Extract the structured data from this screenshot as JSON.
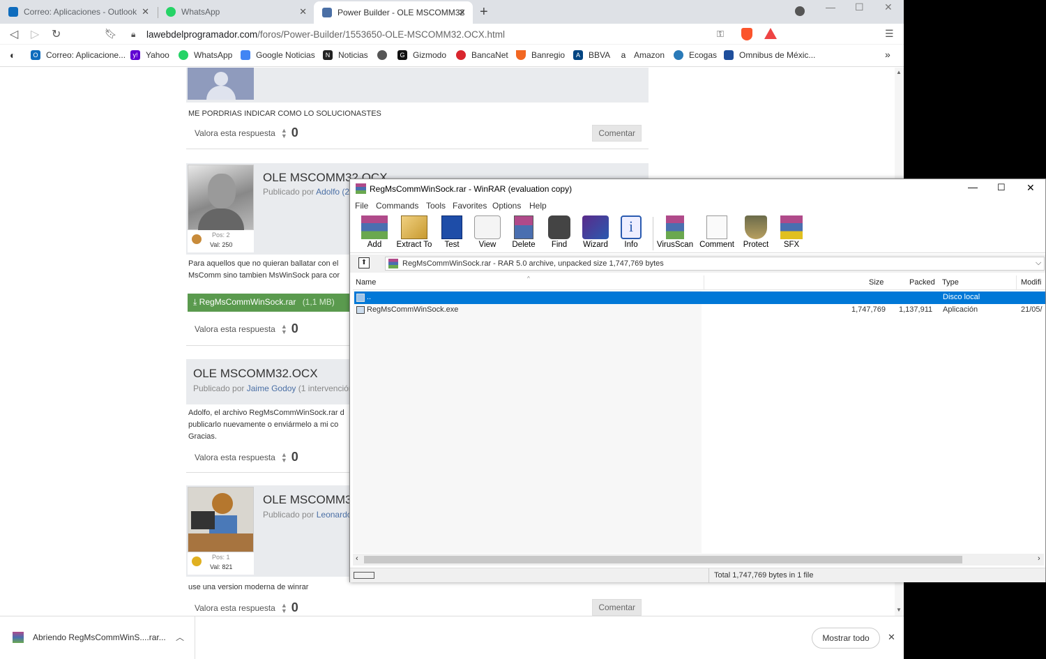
{
  "browser": {
    "tabs": [
      {
        "title": "Correo: Aplicaciones - Outlook",
        "color": "#0f6cbd"
      },
      {
        "title": "WhatsApp",
        "color": "#25d366"
      },
      {
        "title": "Power Builder - OLE MSCOMM32",
        "color": "#4a6fa5"
      }
    ],
    "url_domain": "lawebdelprogramador.com",
    "url_path": "/foros/Power-Builder/1553650-OLE-MSCOMM32.OCX.html",
    "bookmarks": [
      {
        "label": "Correo: Aplicacione...",
        "color": "#0f6cbd"
      },
      {
        "label": "Yahoo",
        "color": "#6001d2"
      },
      {
        "label": "WhatsApp",
        "color": "#25d366"
      },
      {
        "label": "Google Noticias",
        "color": "#4285f4"
      },
      {
        "label": "Noticias",
        "color": "#222"
      },
      {
        "label": "",
        "color": "#555"
      },
      {
        "label": "Gizmodo",
        "color": "#111"
      },
      {
        "label": "BancaNet",
        "color": "#d9262e"
      },
      {
        "label": "Banregio",
        "color": "#f26722"
      },
      {
        "label": "BBVA",
        "color": "#004481"
      },
      {
        "label": "Amazon",
        "color": "#222"
      },
      {
        "label": "Ecogas",
        "color": "#2a7ab8"
      },
      {
        "label": "Omnibus de Méxic...",
        "color": "#1e4e9c"
      }
    ]
  },
  "forum": {
    "post0": {
      "text": "ME PORDRIAS INDICAR COMO LO SOLUCIONASTES",
      "rate_label": "Valora esta respuesta",
      "votes": "0",
      "comment": "Comentar"
    },
    "post1": {
      "title": "OLE MSCOMM32.OCX",
      "published": "Publicado por",
      "author": "Adolfo (2",
      "pos": "Pos: 2",
      "val": "Val: 250",
      "line1": "Para aquellos que no quieran ballatar con el",
      "line2": "MsComm sino tambien MsWinSock para cor",
      "attachment": "RegMsCommWinSock.rar",
      "attachment_size": "(1,1 MB)",
      "rate_label": "Valora esta respuesta",
      "votes": "0"
    },
    "post2": {
      "title": "OLE MSCOMM32.OCX",
      "published": "Publicado por",
      "author": "Jaime Godoy",
      "extra": "(1 intervención",
      "line1": "Adolfo, el archivo RegMsCommWinSock.rar d",
      "line2": "publicarlo nuevamente o enviármelo a mi co",
      "line3": "Gracias.",
      "rate_label": "Valora esta respuesta",
      "votes": "0"
    },
    "post3": {
      "title": "OLE MSCOMM3",
      "published": "Publicado por",
      "author": "Leonardo",
      "pos": "Pos: 1",
      "val": "Val: 821",
      "text": "use una version moderna de winrar",
      "rate_label": "Valora esta respuesta",
      "votes": "0",
      "comment": "Comentar"
    }
  },
  "download": {
    "file": "Abriendo RegMsCommWinS....rar...",
    "show_all": "Mostrar todo"
  },
  "winrar": {
    "title": "RegMsCommWinSock.rar - WinRAR (evaluation copy)",
    "menu": [
      "File",
      "Commands",
      "Tools",
      "Favorites",
      "Options",
      "Help"
    ],
    "tools": [
      "Add",
      "Extract To",
      "Test",
      "View",
      "Delete",
      "Find",
      "Wizard",
      "Info",
      "VirusScan",
      "Comment",
      "Protect",
      "SFX"
    ],
    "path": "RegMsCommWinSock.rar - RAR 5.0 archive, unpacked size 1,747,769 bytes",
    "columns": {
      "name": "Name",
      "size": "Size",
      "packed": "Packed",
      "type": "Type",
      "modified": "Modifi"
    },
    "rows": [
      {
        "name": "..",
        "size": "",
        "packed": "",
        "type": "Disco local",
        "modified": ""
      },
      {
        "name": "RegMsCommWinSock.exe",
        "size": "1,747,769",
        "packed": "1,137,911",
        "type": "Aplicación",
        "modified": "21/05/"
      }
    ],
    "status": "Total 1,747,769 bytes in 1 file",
    "selection_color": "#0078d7"
  }
}
